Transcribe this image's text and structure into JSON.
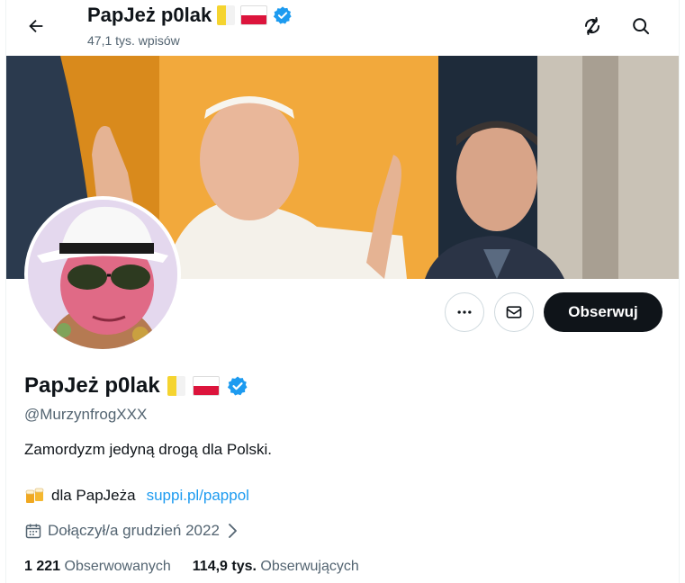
{
  "header": {
    "name": "PapJeż p0lak",
    "posts_count": "47,1 tys. wpisów"
  },
  "profile": {
    "name": "PapJeż p0lak",
    "handle": "@MurzynfrogXXX",
    "bio": "Zamordyzm jedyną drogą dla Polski.",
    "link_prefix": "dla PapJeża",
    "link_text": "suppi.pl/pappol",
    "joined": "Dołączył/a grudzień 2022",
    "following_count": "1 221",
    "following_label": "Obserwowanych",
    "followers_count": "114,9 tys.",
    "followers_label": "Obserwujących"
  },
  "actions": {
    "follow_label": "Obserwuj"
  },
  "icons": {
    "back": "arrow-left-icon",
    "repost": "repost-icon",
    "search": "search-icon",
    "more": "more-icon",
    "message": "envelope-icon",
    "verified": "verified-badge-icon",
    "calendar": "calendar-icon",
    "chevron": "chevron-right-icon",
    "beer": "beer-icon"
  },
  "colors": {
    "accent": "#1d9bf0",
    "text": "#0f1419",
    "secondary": "#536471",
    "follow_bg": "#0f1419"
  }
}
